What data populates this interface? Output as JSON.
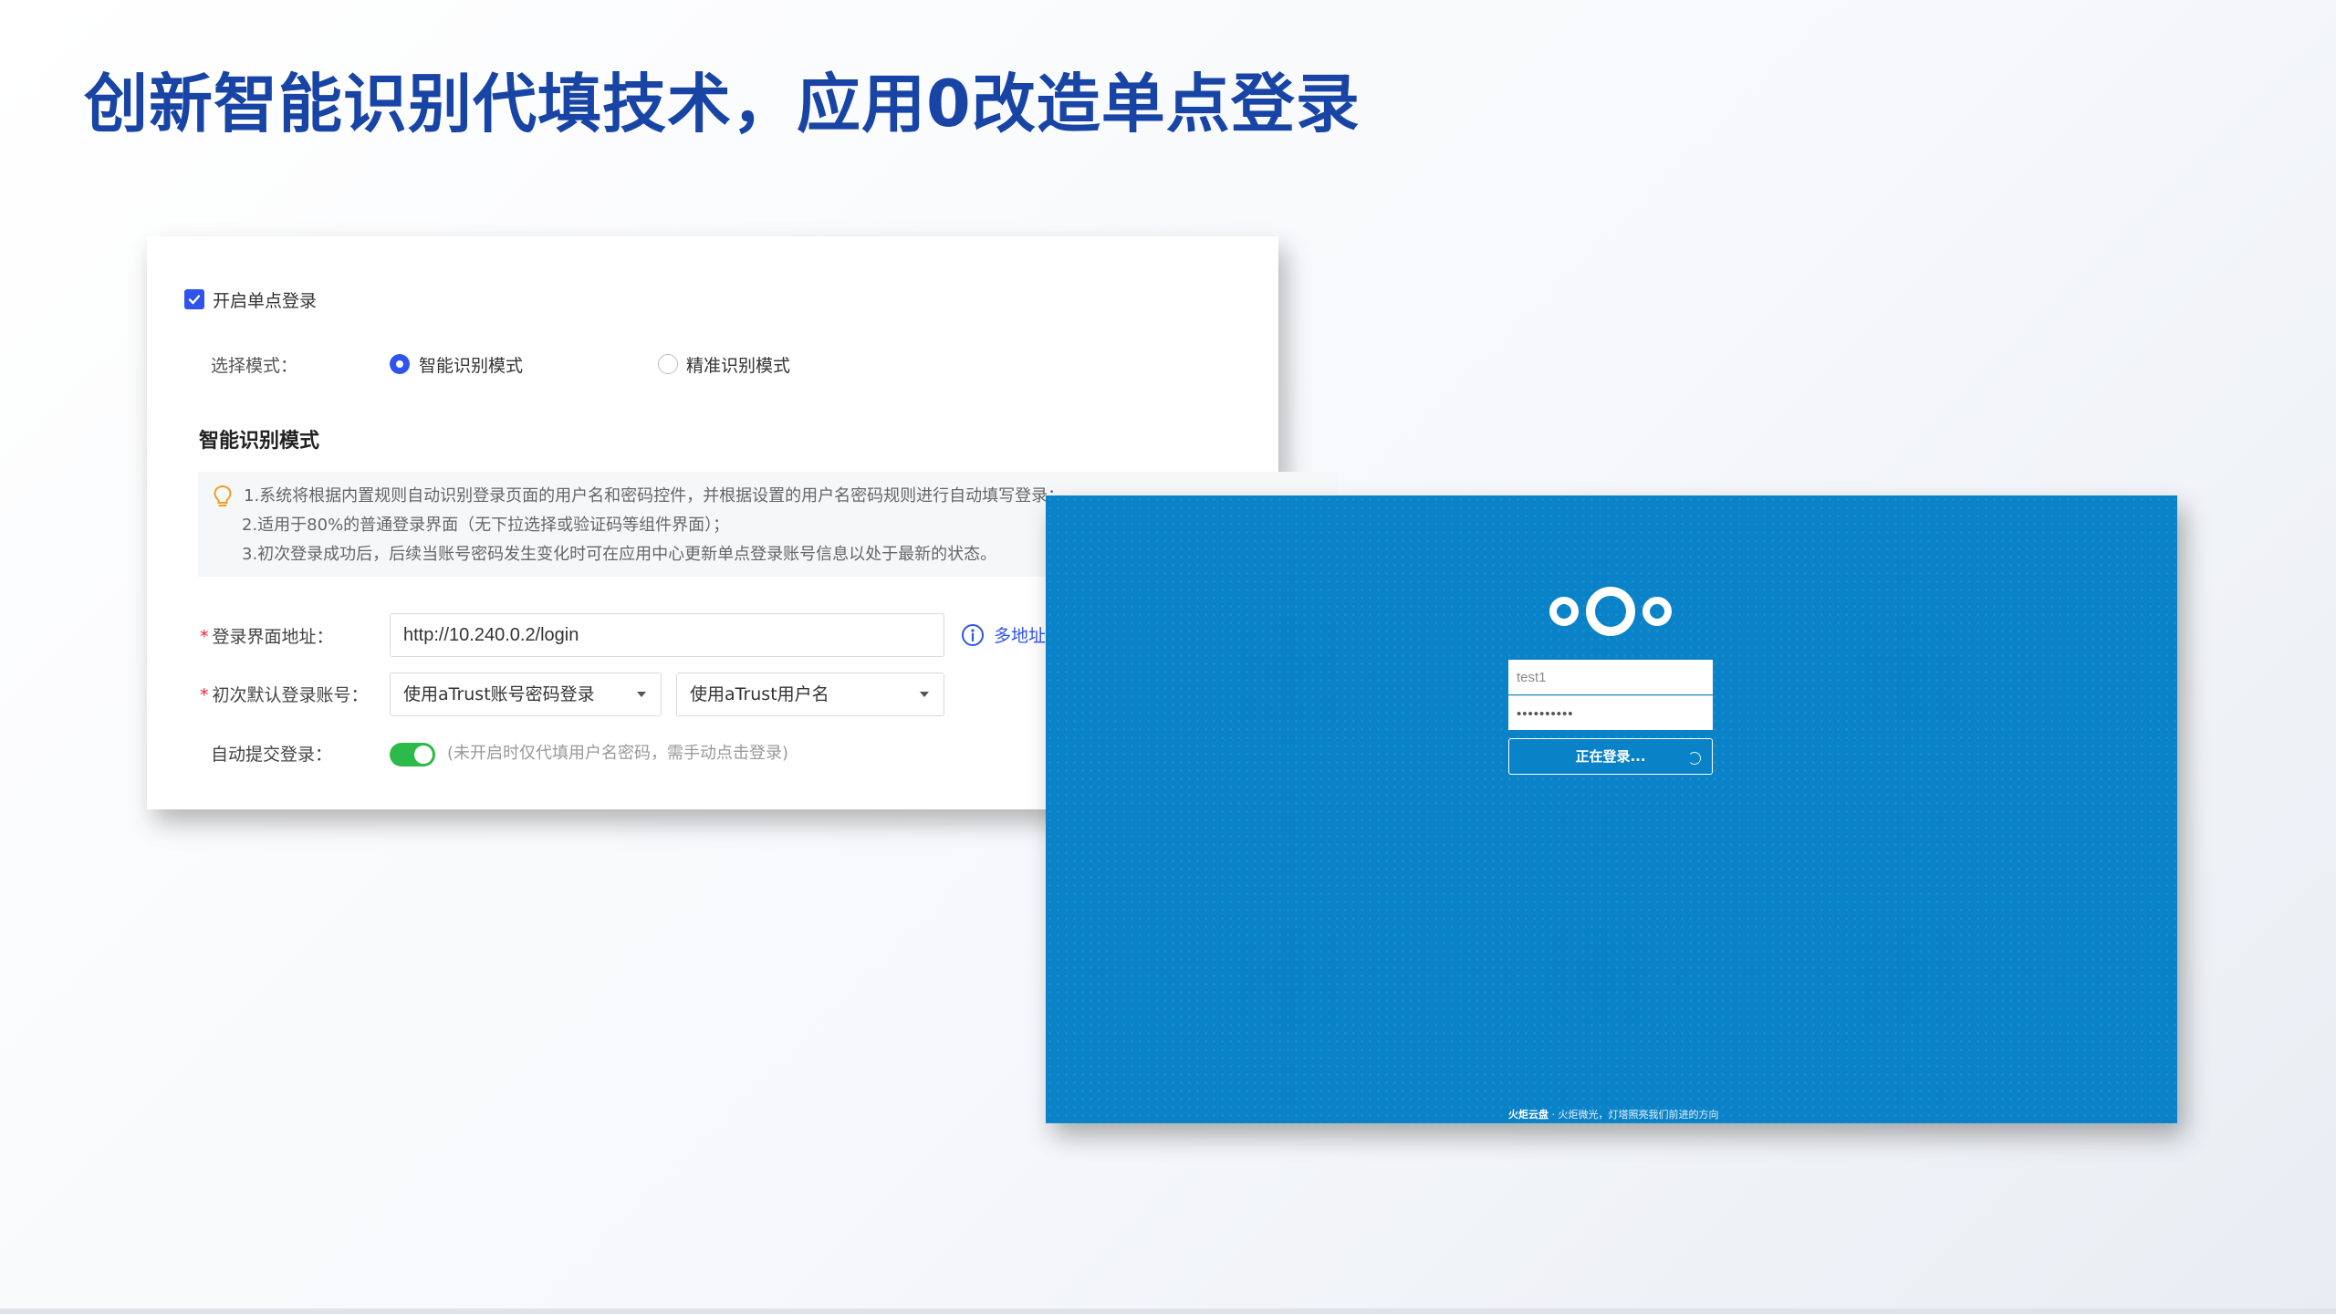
{
  "slide": {
    "title": "创新智能识别代填技术，应用0改造单点登录"
  },
  "sso_panel": {
    "enable_label": "开启单点登录",
    "enable_checked": true,
    "mode_label": "选择模式：",
    "mode_options": [
      "智能识别模式",
      "精准识别模式"
    ],
    "mode_selected": "智能识别模式",
    "section_title": "智能识别模式",
    "tips": [
      "1.系统将根据内置规则自动识别登录页面的用户名和密码控件，并根据设置的用户名密码规则进行自动填写登录；",
      "2.适用于80%的普通登录界面（无下拉选择或验证码等组件界面）；",
      "3.初次登录成功后，后续当账号密码发生变化时可在应用中心更新单点登录账号信息以处于最新的状态。"
    ],
    "required_mark": "*",
    "login_url_label": "登录界面地址：",
    "login_url_value": "http://10.240.0.2/login",
    "multi_address_link": "多地址",
    "default_account_label": "初次默认登录账号：",
    "account_select_value": "使用aTrust账号密码登录",
    "username_select_value": "使用aTrust用户名",
    "auto_submit_label": "自动提交登录：",
    "auto_submit_on": true,
    "auto_submit_hint": "(未开启时仅代填用户名密码，需手动点击登录)"
  },
  "login_screen": {
    "username_value": "test1",
    "password_value": "••••••••••",
    "login_button": "正在登录...",
    "footer_brand": "火炬云盘",
    "footer_text": " · 火炬微光，灯塔照亮我们前进的方向",
    "background_color": "#0a82c8"
  },
  "colors": {
    "title": "#1845a5",
    "accent": "#2f54eb",
    "switch_on": "#2cbb4a"
  },
  "icons": [
    "check-icon",
    "lightbulb-icon",
    "info-icon",
    "chevron-down-icon",
    "nextcloud-logo-icon",
    "spinner-icon"
  ]
}
